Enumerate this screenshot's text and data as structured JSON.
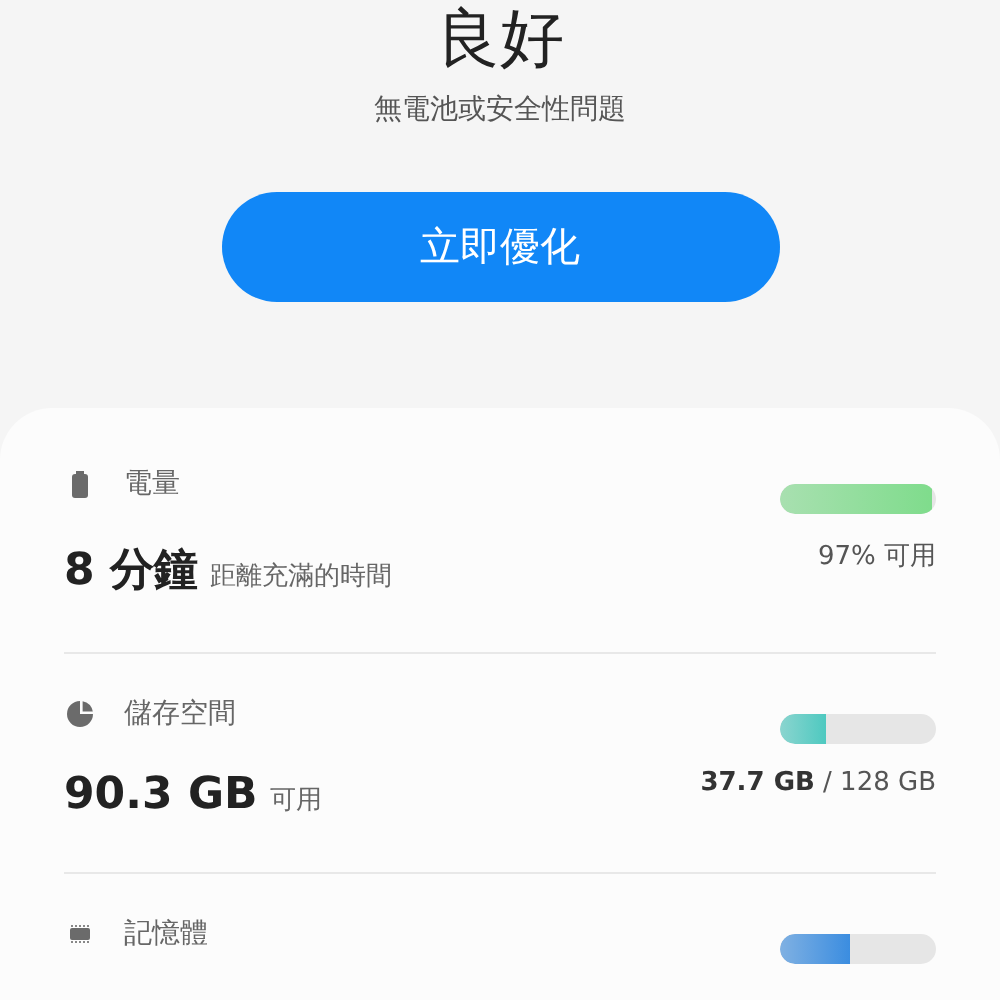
{
  "status": {
    "title": "良好",
    "subtitle": "無電池或安全性問題"
  },
  "optimize_button": {
    "label": "立即優化"
  },
  "items": [
    {
      "kind": "battery",
      "label": "電量",
      "value": "8 分鐘",
      "value_note": "距離充滿的時間",
      "level": 0.97,
      "color": "#7fdc8c",
      "reading": "97% 可用"
    },
    {
      "kind": "storage",
      "label": "儲存空間",
      "value": "90.3 GB",
      "value_note": "可用",
      "level": 0.3,
      "color": "#4ec9c0",
      "reading": "**37.7 GB** / 128 GB"
    },
    {
      "kind": "memory",
      "label": "記憶體",
      "level": 0.45,
      "color": "#3b8de0"
    }
  ]
}
